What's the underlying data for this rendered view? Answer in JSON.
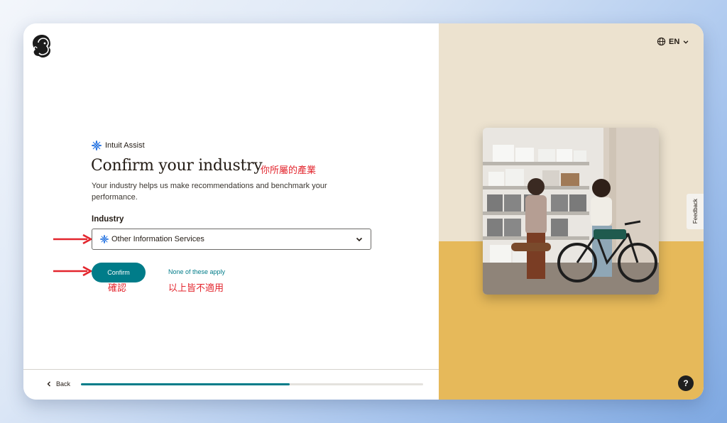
{
  "header": {
    "language_label": "EN"
  },
  "assist": {
    "label": "Intuit Assist"
  },
  "main": {
    "title": "Confirm your industry",
    "title_annotation": "你所屬的產業",
    "description": "Your industry helps us make recommendations and benchmark your performance.",
    "industry_label": "Industry",
    "industry_value": "Other Information Services",
    "confirm_label": "Confirm",
    "confirm_annotation": "確認",
    "none_label": "None of these apply",
    "none_annotation": "以上皆不適用"
  },
  "footer": {
    "back_label": "Back",
    "progress": 0.61
  },
  "side": {
    "feedback_label": "Feedback",
    "help_label": "?"
  },
  "colors": {
    "accent": "#007c89",
    "annotation": "#e3262e",
    "panel_top": "#ece2cf",
    "panel_bottom": "#e6b95a"
  },
  "icons": [
    "mailchimp-logo-icon",
    "sparkle-icon",
    "chevron-down-icon",
    "globe-icon",
    "arrow-right-icon",
    "chevron-left-icon"
  ]
}
